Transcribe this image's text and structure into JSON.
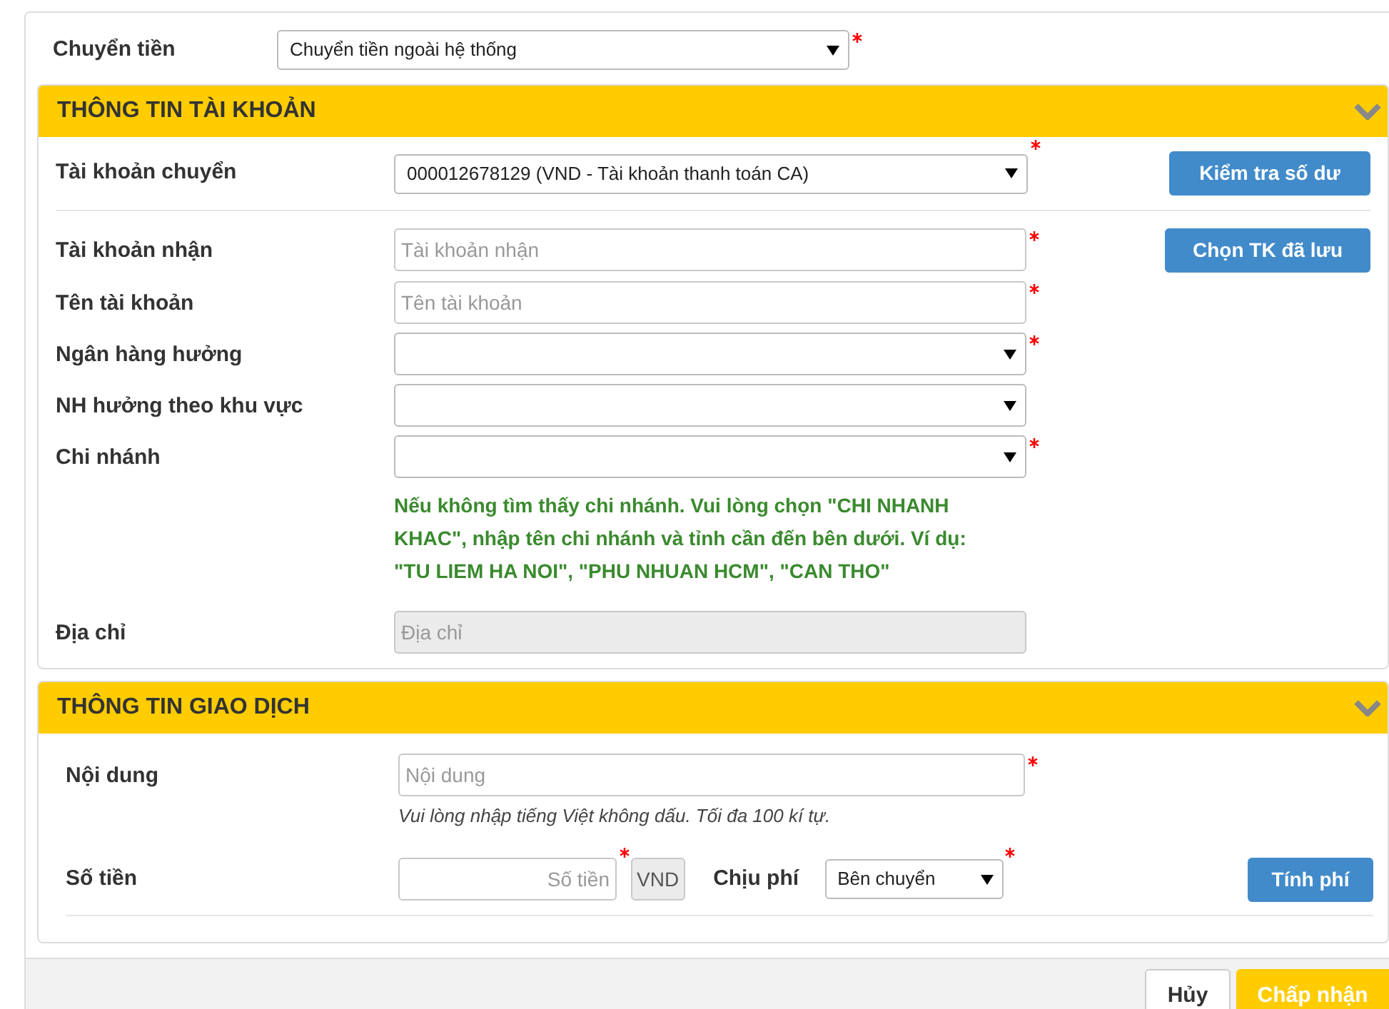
{
  "transfer_type": {
    "label": "Chuyển tiền",
    "value": "Chuyển tiền ngoài hệ thống",
    "required": true
  },
  "account_section": {
    "title": "THÔNG TIN TÀI KHOẢN",
    "expanded": true,
    "source": {
      "label": "Tài khoản chuyển",
      "kind": "select",
      "value": "000012678129 (VND - Tài khoản thanh toán CA)",
      "required": true,
      "button": "Kiểm tra số dư"
    },
    "fields": [
      {
        "label": "Tài khoản nhận",
        "kind": "input",
        "placeholder": "Tài khoản nhận",
        "required": true,
        "button": "Chọn TK đã lưu"
      },
      {
        "label": "Tên tài khoản",
        "kind": "input",
        "placeholder": "Tên tài khoản",
        "required": true
      },
      {
        "label": "Ngân hàng hưởng",
        "kind": "select",
        "required": true
      },
      {
        "label": "NH hưởng theo khu vực",
        "kind": "select"
      },
      {
        "label": "Chi nhánh",
        "kind": "select",
        "required": true,
        "note": "Nếu không tìm thấy chi nhánh. Vui lòng chọn \"CHI NHANH KHAC\", nhập tên chi nhánh và tỉnh cần đến bên dưới. Ví dụ: \"TU LIEM HA NOI\", \"PHU NHUAN HCM\", \"CAN THO\""
      },
      {
        "label": "Địa chỉ",
        "kind": "input",
        "placeholder": "Địa chỉ",
        "disabled": true
      }
    ]
  },
  "transaction_section": {
    "title": "THÔNG TIN GIAO DỊCH",
    "expanded": true,
    "content": {
      "label": "Nội dung",
      "placeholder": "Nội dung",
      "required": true,
      "hint": "Vui lòng nhập tiếng Việt không dấu. Tối đa 100 kí tự."
    },
    "amount": {
      "label": "Số tiền",
      "placeholder": "Số tiền",
      "required": true,
      "unit": "VND"
    },
    "fee": {
      "label": "Chịu phí",
      "value": "Bên chuyển",
      "required": true,
      "button": "Tính phí"
    }
  },
  "footer": {
    "cancel": "Hủy",
    "accept": "Chấp nhận"
  }
}
